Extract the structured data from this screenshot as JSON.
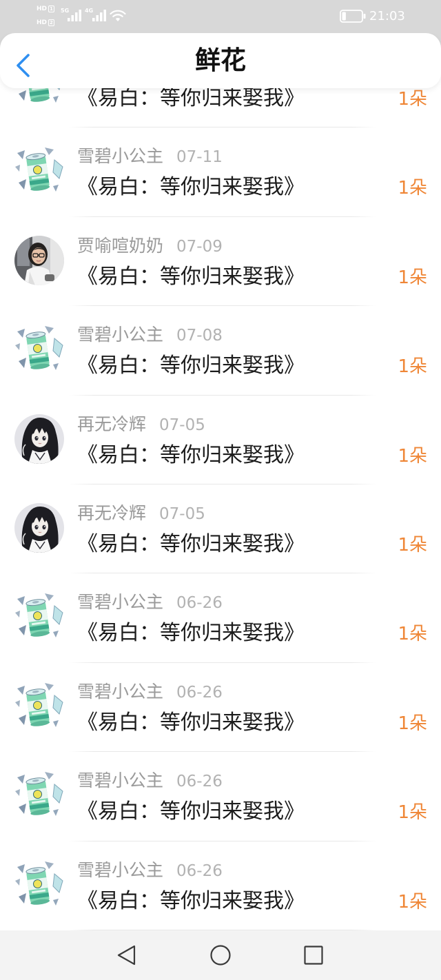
{
  "theme": {
    "status_bar_bg": "#d8d8d8",
    "accent_blue": "#2f8ff0",
    "count_orange": "#ef8636",
    "name_gray": "#9a9a9a",
    "date_gray": "#b2b2b2"
  },
  "status_bar": {
    "hd_label": "HD",
    "sim1_slot": "1",
    "sim2_slot": "2",
    "network_sim1": "5G",
    "network_sim2": "4G",
    "battery_level_percent": 20,
    "time": "21:03",
    "icons": [
      "signal-bars-icon",
      "wifi-icon",
      "battery-icon"
    ]
  },
  "header": {
    "back_icon": "chevron-left-icon",
    "title": "鲜花"
  },
  "list": {
    "items": [
      {
        "avatar": "soda-can",
        "book": "《易白：等你归来娶我》",
        "count": "1朵"
      },
      {
        "avatar": "soda-can",
        "name": "雪碧小公主",
        "date": "07-11",
        "book": "《易白：等你归来娶我》",
        "count": "1朵"
      },
      {
        "avatar": "girl-photo",
        "name": "贾喻喧奶奶",
        "date": "07-09",
        "book": "《易白：等你归来娶我》",
        "count": "1朵"
      },
      {
        "avatar": "soda-can",
        "name": "雪碧小公主",
        "date": "07-08",
        "book": "《易白：等你归来娶我》",
        "count": "1朵"
      },
      {
        "avatar": "anime-girl",
        "name": "再无冷辉",
        "date": "07-05",
        "book": "《易白：等你归来娶我》",
        "count": "1朵"
      },
      {
        "avatar": "anime-girl",
        "name": "再无冷辉",
        "date": "07-05",
        "book": "《易白：等你归来娶我》",
        "count": "1朵"
      },
      {
        "avatar": "soda-can",
        "name": "雪碧小公主",
        "date": "06-26",
        "book": "《易白：等你归来娶我》",
        "count": "1朵"
      },
      {
        "avatar": "soda-can",
        "name": "雪碧小公主",
        "date": "06-26",
        "book": "《易白：等你归来娶我》",
        "count": "1朵"
      },
      {
        "avatar": "soda-can",
        "name": "雪碧小公主",
        "date": "06-26",
        "book": "《易白：等你归来娶我》",
        "count": "1朵"
      },
      {
        "avatar": "soda-can",
        "name": "雪碧小公主",
        "date": "06-26",
        "book": "《易白：等你归来娶我》",
        "count": "1朵"
      }
    ]
  },
  "nav_bar": {
    "icons": [
      "back-triangle-icon",
      "home-circle-icon",
      "recents-square-icon"
    ]
  }
}
